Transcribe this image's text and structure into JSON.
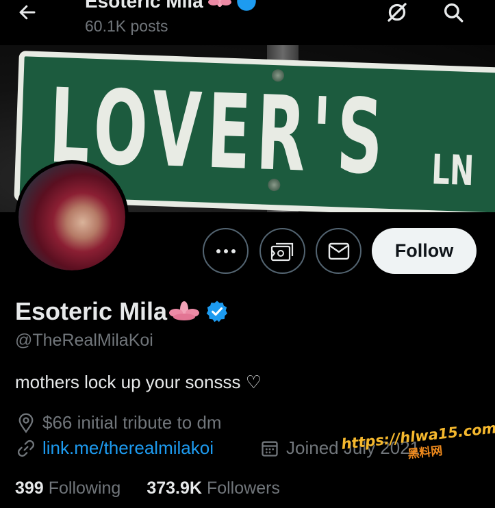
{
  "header": {
    "title": "Esoteric Mila",
    "posts": "60.1K posts"
  },
  "banner": {
    "sign_text": "LOVER'S",
    "sign_suffix": "LN"
  },
  "profile": {
    "name": "Esoteric Mila",
    "handle": "@TheRealMilaKoi",
    "bio": "mothers lock up your sonsss ♡",
    "location": "$66 initial tribute to dm",
    "website": "link.me/therealmilakoi",
    "joined": "Joined July 2021",
    "following_count": "399",
    "following_label": "Following",
    "followers_count": "373.9K",
    "followers_label": "Followers"
  },
  "actions": {
    "follow_label": "Follow"
  },
  "watermark": {
    "url": "https://hlwa15.com",
    "cn": "黑料网"
  },
  "colors": {
    "background": "#000000",
    "accent": "#1d9bf0",
    "secondary_text": "#71767b",
    "verified": "#1d9bf0"
  },
  "icons": [
    "back-arrow-icon",
    "no-notify-icon",
    "search-icon",
    "more-icon",
    "tip-icon",
    "message-icon",
    "location-icon",
    "link-icon",
    "calendar-icon",
    "verified-icon",
    "lotus-icon"
  ]
}
